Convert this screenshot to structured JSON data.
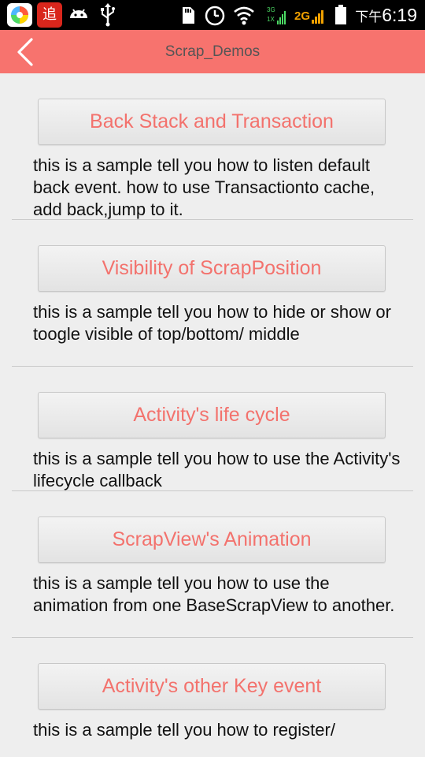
{
  "status_bar": {
    "clock_ampm": "下午",
    "clock_time": "6:19",
    "network_label": "2G",
    "app_badge": "追",
    "data_3g": "3G",
    "data_1x": "1X",
    "icons": [
      "browser-app-icon",
      "zhui-app-icon",
      "android-icon",
      "usb-icon",
      "sd-card-icon",
      "alarm-clock-icon",
      "wifi-icon",
      "signal-3g-icon",
      "signal-2g-icon",
      "battery-icon"
    ]
  },
  "action_bar": {
    "title": "Scrap_Demos",
    "back_icon": "chevron-left-icon"
  },
  "demos": [
    {
      "button_label": "Back Stack and Transaction",
      "description": "this is a sample tell you how to listen default back event. how to use Transactionto cache, add back,jump to it."
    },
    {
      "button_label": "Visibility of ScrapPosition",
      "description": "this is a sample tell you how to hide or show or toogle visible of top/bottom/ middle"
    },
    {
      "button_label": "Activity's life cycle",
      "description": "this is a sample tell you how to use the Activity's lifecycle callback"
    },
    {
      "button_label": "ScrapView's Animation",
      "description": "this is a sample tell you how to use the animation from one BaseScrapView to another."
    },
    {
      "button_label": "Activity's other Key event",
      "description": "this is a sample tell you how to register/"
    }
  ],
  "colors": {
    "accent": "#f7736e",
    "button_text": "#f3726d",
    "background": "#eeeeee"
  }
}
